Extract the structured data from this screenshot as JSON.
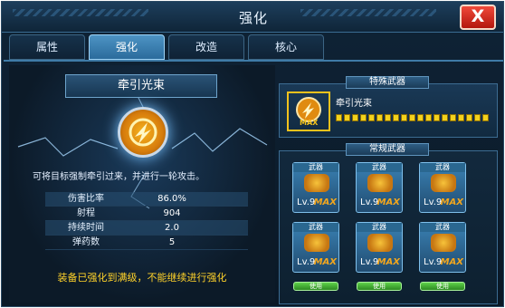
{
  "window": {
    "title": "强化",
    "close_label": "X"
  },
  "tabs": [
    {
      "label": "属性"
    },
    {
      "label": "强化"
    },
    {
      "label": "改造"
    },
    {
      "label": "核心"
    }
  ],
  "item": {
    "name": "牵引光束",
    "description": "可将目标强制牵引过来，并进行一轮攻击。",
    "stats": [
      {
        "label": "伤害比率",
        "value": "86.0%"
      },
      {
        "label": "射程",
        "value": "904"
      },
      {
        "label": "持续时间",
        "value": "2.0"
      },
      {
        "label": "弹药数",
        "value": "5"
      }
    ],
    "notice": "装备已强化到满级，不能继续进行强化"
  },
  "special_weapon": {
    "title": "特殊武器",
    "name": "牵引光束",
    "max_label": "MAX",
    "level_fraction": 1.0
  },
  "normal_weapons": {
    "title": "常规武器",
    "cards": [
      {
        "head": "武器",
        "level": "Lv.9",
        "max": "MAX"
      },
      {
        "head": "武器",
        "level": "Lv.9",
        "max": "MAX"
      },
      {
        "head": "武器",
        "level": "Lv.9",
        "max": "MAX"
      },
      {
        "head": "武器",
        "level": "Lv.9",
        "max": "MAX"
      },
      {
        "head": "武器",
        "level": "Lv.9",
        "max": "MAX"
      },
      {
        "head": "武器",
        "level": "Lv.9",
        "max": "MAX"
      }
    ],
    "button_label": "使用"
  },
  "colors": {
    "accent": "#ffd22a",
    "active_tab": "#4d94c4",
    "close": "#d62a1e"
  }
}
